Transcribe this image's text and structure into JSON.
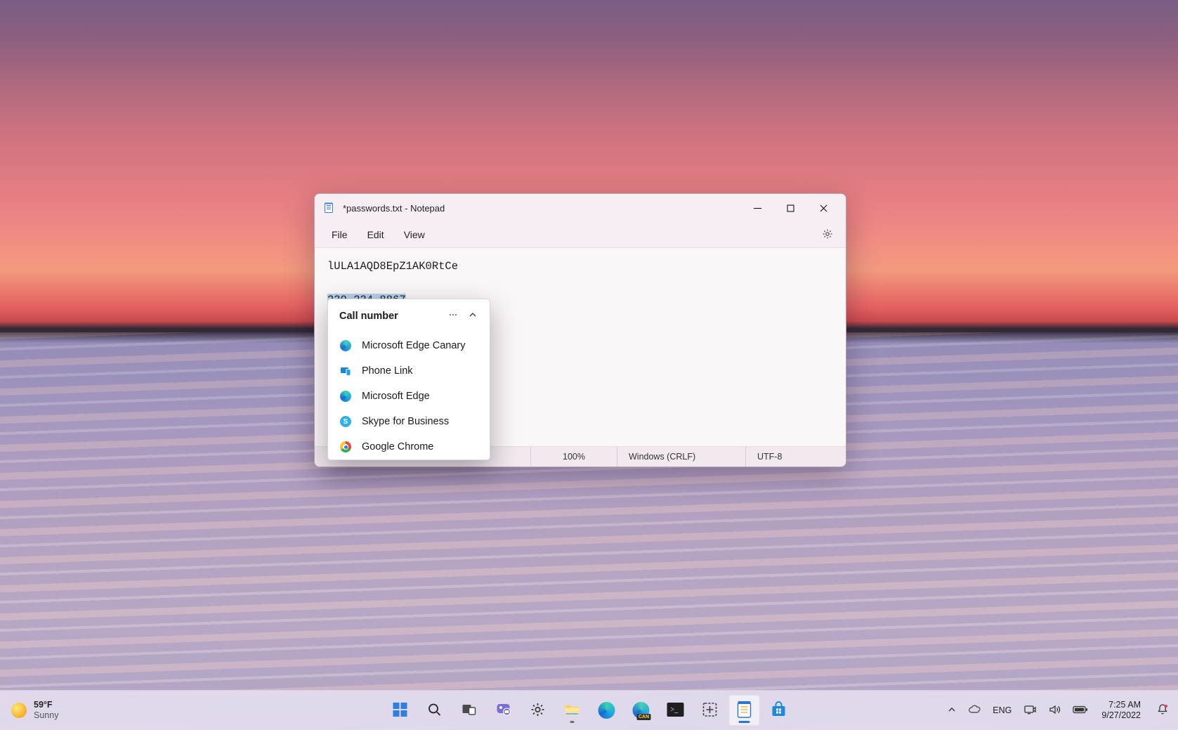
{
  "notepad": {
    "title": "*passwords.txt - Notepad",
    "menus": {
      "file": "File",
      "edit": "Edit",
      "view": "View"
    },
    "content": {
      "line1": "lULA1AQD8EpZ1AK0RtCe",
      "line2_selected": "239-234-8867"
    },
    "status": {
      "zoom": "100%",
      "eol": "Windows (CRLF)",
      "encoding": "UTF-8"
    }
  },
  "popup": {
    "title": "Call number",
    "apps": [
      {
        "name": "Microsoft Edge Canary",
        "icon": "edge-canary-icon"
      },
      {
        "name": "Phone Link",
        "icon": "phone-link-icon"
      },
      {
        "name": "Microsoft Edge",
        "icon": "edge-icon"
      },
      {
        "name": "Skype for Business",
        "icon": "skype-icon"
      },
      {
        "name": "Google Chrome",
        "icon": "chrome-icon"
      }
    ]
  },
  "taskbar": {
    "weather": {
      "temp": "59°F",
      "cond": "Sunny"
    },
    "tray": {
      "lang": "ENG",
      "time": "7:25 AM",
      "date": "9/27/2022"
    }
  }
}
